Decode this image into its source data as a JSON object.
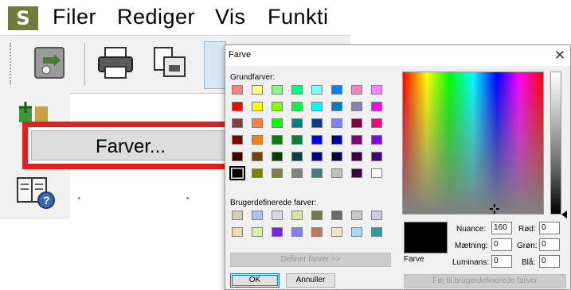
{
  "app": {
    "logo": "S",
    "menu": [
      "Filer",
      "Rediger",
      "Vis",
      "Funkti"
    ],
    "toolbar_icons": [
      "recycle-icon",
      "printer-icon",
      "copy-icon"
    ],
    "side_icons": [
      "color-wheel-icon",
      "help-book-icon"
    ],
    "highlighted_menu_item": "Farver..."
  },
  "dialog": {
    "title": "Farve",
    "close_glyph": "✕",
    "basic_colors_label": "Grundfarver:",
    "basic_colors": [
      [
        "#ff8080",
        "#ffff80",
        "#80ff80",
        "#00ff80",
        "#80ffff",
        "#0080ff",
        "#ff80c0",
        "#ff80ff"
      ],
      [
        "#ff0000",
        "#ffff00",
        "#80ff00",
        "#00ff40",
        "#00ffff",
        "#0080c0",
        "#8080c0",
        "#ff00ff"
      ],
      [
        "#804040",
        "#ff8040",
        "#00ff00",
        "#008080",
        "#004080",
        "#8080ff",
        "#800040",
        "#ff0080"
      ],
      [
        "#800000",
        "#ff8000",
        "#008000",
        "#008040",
        "#0000ff",
        "#0000a0",
        "#800080",
        "#8000ff"
      ],
      [
        "#400000",
        "#804000",
        "#004000",
        "#004040",
        "#000080",
        "#000040",
        "#400040",
        "#400080"
      ],
      [
        "#000000",
        "#808000",
        "#808040",
        "#808080",
        "#408080",
        "#c0c0c0",
        "#400040",
        "#ffffff"
      ]
    ],
    "custom_colors_label": "Brugerdefinerede farver:",
    "custom_colors": [
      [
        "#d4d0b0",
        "#a8c4e8",
        "#d8d8e8",
        "#d8e4a0",
        "#707a4c",
        "#6a6a6a",
        "#c8c8c8",
        "#c8d0e0"
      ],
      [
        "#f0d8b0",
        "#d8f0a8",
        "#8020e0",
        "#8080f0",
        "#c07850",
        "#f0e4c0",
        "#a0d8f0",
        "#2c9aa8"
      ]
    ],
    "define_button": "Definer farver >>",
    "ok_button": "OK",
    "cancel_button": "Annuller",
    "preview_label": "Farve",
    "hue_label": "Nuance:",
    "hue_value": "160",
    "sat_label": "Mætning:",
    "sat_value": "0",
    "lum_label": "Luminans:",
    "lum_value": "0",
    "red_label": "Rød:",
    "red_value": "0",
    "green_label": "Grøn:",
    "green_value": "0",
    "blue_label": "Blå:",
    "blue_value": "0",
    "add_custom_button": "Føj til brugerdefinerede farver"
  }
}
